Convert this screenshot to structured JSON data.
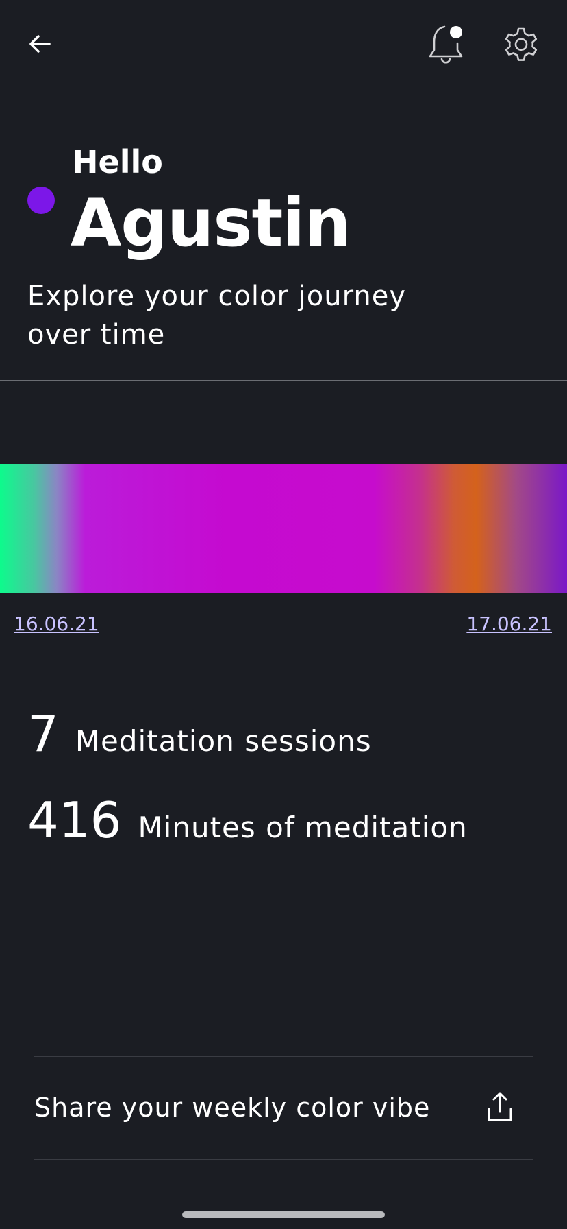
{
  "header": {
    "back_icon": "arrow-left-icon",
    "notification_icon": "bell-icon",
    "settings_icon": "gear-icon"
  },
  "greeting": {
    "hello": "Hello",
    "name": "Agustin",
    "subtitle": "Explore your color journey over time",
    "status_dot_color": "#7c17e8"
  },
  "color_journey": {
    "start_date": "16.06.21",
    "end_date": "17.06.21",
    "gradient_colors": [
      "#0dfb8c",
      "#c50ad0",
      "#d4621c",
      "#7a18c8"
    ]
  },
  "stats": [
    {
      "value": "7",
      "label": "Meditation sessions"
    },
    {
      "value": "416",
      "label": "Minutes of meditation"
    }
  ],
  "share": {
    "label": "Share your weekly color vibe",
    "icon": "share-upload-icon"
  },
  "colors": {
    "background": "#1b1d23",
    "date_link": "#c9c3ff"
  }
}
